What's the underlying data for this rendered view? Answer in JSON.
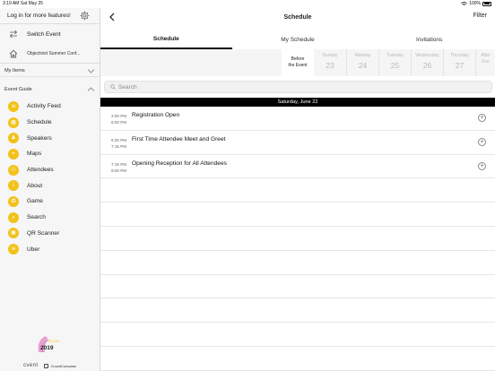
{
  "status_bar": {
    "time": "3:19 AM",
    "date": "Sat May 25",
    "battery": "100%"
  },
  "sidebar": {
    "login": "Log in for more features!",
    "switch_event": "Switch Event",
    "conference": "Objectivist Summer Conf...",
    "my_items": "My Items",
    "event_guide": "Event Guide",
    "items": [
      {
        "label": "Activity Feed",
        "icon": "activity-feed-icon",
        "glyph": "≡"
      },
      {
        "label": "Schedule",
        "icon": "schedule-icon",
        "glyph": "▦"
      },
      {
        "label": "Speakers",
        "icon": "speakers-icon",
        "glyph": "♟"
      },
      {
        "label": "Maps",
        "icon": "maps-icon",
        "glyph": "⌖"
      },
      {
        "label": "Attendees",
        "icon": "attendees-icon",
        "glyph": "⚇"
      },
      {
        "label": "About",
        "icon": "about-icon",
        "glyph": "i"
      },
      {
        "label": "Game",
        "icon": "game-icon",
        "glyph": "✪"
      },
      {
        "label": "Search",
        "icon": "search-icon",
        "glyph": "⌕"
      },
      {
        "label": "QR Scanner",
        "icon": "qr-scanner-icon",
        "glyph": "▣"
      },
      {
        "label": "Uber",
        "icon": "uber-icon",
        "glyph": "≡"
      }
    ],
    "logo_text": "2019",
    "footer_cvent": "cvent",
    "footer_cc": "CrowdCompass"
  },
  "main": {
    "title": "Schedule",
    "filter": "Filter",
    "tabs": [
      {
        "label": "Schedule"
      },
      {
        "label": "My Schedule"
      },
      {
        "label": "Invitations"
      }
    ],
    "before_event": [
      "Before",
      "the Event"
    ],
    "days": [
      {
        "name": "Sunday",
        "date": "23"
      },
      {
        "name": "Monday",
        "date": "24"
      },
      {
        "name": "Tuesday",
        "date": "25"
      },
      {
        "name": "Wednesday",
        "date": "26"
      },
      {
        "name": "Thursday",
        "date": "27"
      },
      {
        "name": "After",
        "date": "Eve"
      }
    ],
    "search_placeholder": "Search",
    "date_header": "Saturday, June 22",
    "sessions": [
      {
        "start": "2:00 PM",
        "end": "6:00 PM",
        "title": "Registration Open"
      },
      {
        "start": "6:30 PM",
        "end": "7:15 PM",
        "title": "First Time Attendee Meet and Greet"
      },
      {
        "start": "7:15 PM",
        "end": "9:00 PM",
        "title": "Opening Reception for All Attendees"
      }
    ]
  },
  "colors": {
    "accent": "#f3c219",
    "date_header_bg": "#000000",
    "tab_active": "#111111"
  }
}
